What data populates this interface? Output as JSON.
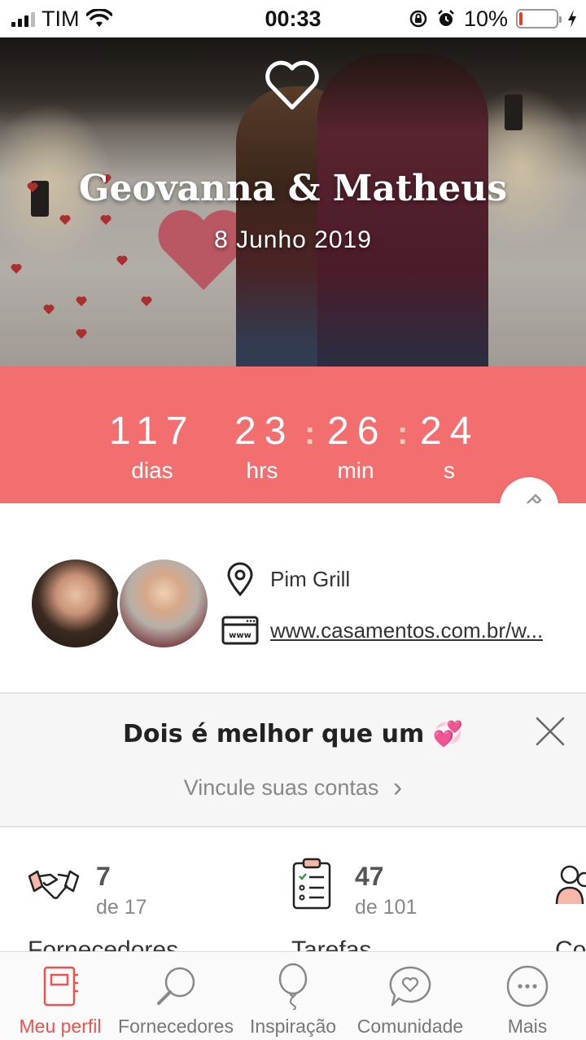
{
  "status_bar": {
    "carrier": "TIM",
    "time": "00:33",
    "battery": "10%",
    "battery_level": 0.1
  },
  "hero": {
    "couple_names": "Geovanna & Matheus",
    "wedding_date": "8 Junho 2019"
  },
  "countdown": {
    "days": "117",
    "hours": "23",
    "minutes": "26",
    "seconds": "24",
    "days_label": "dias",
    "hours_label": "hrs",
    "minutes_label": "min",
    "seconds_label": "s",
    "separator": ":",
    "accent_color": "#f36e6e"
  },
  "profile": {
    "venue": "Pim Grill",
    "website": "www.casamentos.com.br/w..."
  },
  "link_banner": {
    "title": "Dois é melhor que um 💞",
    "action": "Vincule suas contas",
    "action_chevron": "›"
  },
  "summary": [
    {
      "count": "7",
      "total": "de 17",
      "label": "Fornecedores",
      "icon": "handshake-icon"
    },
    {
      "count": "47",
      "total": "de 101",
      "label": "Tarefas",
      "icon": "checklist-icon"
    },
    {
      "count": "",
      "total": "",
      "label": "Co",
      "icon": "guests-icon"
    }
  ],
  "tabs": [
    {
      "label": "Meu perfil",
      "icon": "notebook-icon",
      "active": true
    },
    {
      "label": "Fornecedores",
      "icon": "magnifier-icon",
      "active": false
    },
    {
      "label": "Inspiração",
      "icon": "balloon-icon",
      "active": false
    },
    {
      "label": "Comunidade",
      "icon": "chat-heart-icon",
      "active": false
    },
    {
      "label": "Mais",
      "icon": "more-icon",
      "active": false
    }
  ]
}
